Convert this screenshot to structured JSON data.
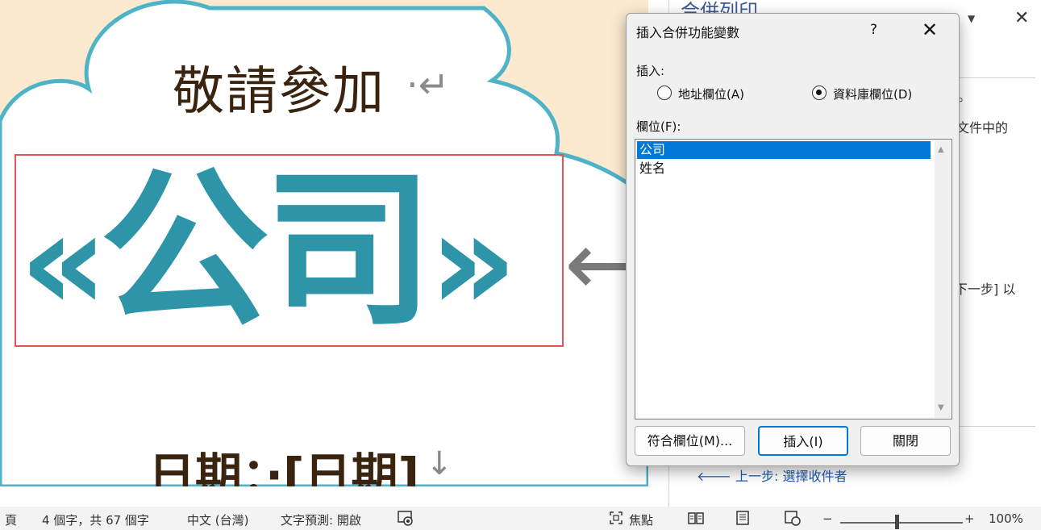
{
  "document": {
    "invite_text": "敬請參加",
    "para_mark": "·↵",
    "company_field": "公司",
    "guillemet_open": "«",
    "guillemet_close": "»",
    "arrow": "←",
    "date_line": "日期：·[日期]",
    "date_mark": "↓"
  },
  "colors": {
    "accent_teal": "#2e95a8",
    "highlight_border": "#e15555",
    "selection_blue": "#0078d7"
  },
  "task_pane": {
    "title": "合併列印",
    "text_1": "。",
    "text_2": "文件中的",
    "text_3": "下一步] 以",
    "back_link": "上一步: 選擇收件者",
    "back_icon": "arrow-left-icon"
  },
  "dialog": {
    "title": "插入合併功能變數",
    "help": "?",
    "close": "✕",
    "insert_label": "插入:",
    "radio_address": "地址欄位(A)",
    "radio_database": "資料庫欄位(D)",
    "selected_radio": "database",
    "fields_label": "欄位(F):",
    "fields": [
      "公司",
      "姓名"
    ],
    "selected_field": "公司",
    "buttons": {
      "match": "符合欄位(M)...",
      "insert": "插入(I)",
      "close": "關閉"
    }
  },
  "statusbar": {
    "page": "頁",
    "word_count": "4 個字，共 67 個字",
    "language": "中文 (台灣)",
    "predict": "文字預測: 開啟",
    "focus": "焦點",
    "zoom_minus": "−",
    "zoom_plus": "+",
    "zoom_level": "100%",
    "zoom_fraction": 0.45
  }
}
